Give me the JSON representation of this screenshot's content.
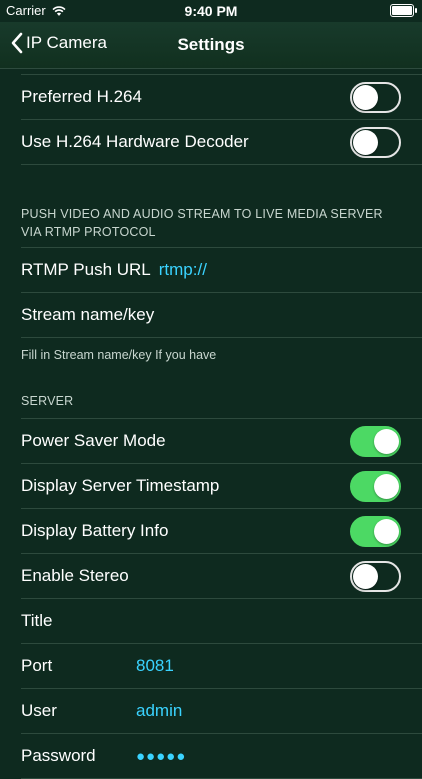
{
  "status_bar": {
    "carrier": "Carrier",
    "time": "9:40 PM"
  },
  "nav": {
    "back_label": "IP Camera",
    "title": "Settings"
  },
  "video": {
    "preferred_h264": {
      "label": "Preferred H.264",
      "on": false
    },
    "hw_decoder": {
      "label": "Use H.264 Hardware Decoder",
      "on": false
    }
  },
  "rtmp": {
    "header": "PUSH VIDEO AND AUDIO STREAM TO LIVE MEDIA SERVER VIA RTMP PROTOCOL",
    "push_url_label": "RTMP Push URL",
    "push_url_value": "rtmp://",
    "stream_key_label": "Stream name/key",
    "footer": "Fill in Stream name/key If you have"
  },
  "server": {
    "header": "SERVER",
    "power_saver": {
      "label": "Power Saver Mode",
      "on": true
    },
    "timestamp": {
      "label": "Display Server Timestamp",
      "on": true
    },
    "battery_info": {
      "label": "Display Battery Info",
      "on": true
    },
    "stereo": {
      "label": "Enable Stereo",
      "on": false
    },
    "title_label": "Title",
    "port_label": "Port",
    "port_value": "8081",
    "user_label": "User",
    "user_value": "admin",
    "password_label": "Password",
    "password_value": "●●●●●"
  },
  "colors": {
    "background": "#0e2a1f",
    "accent": "#3ad3ff",
    "toggle_on": "#4cd964"
  }
}
